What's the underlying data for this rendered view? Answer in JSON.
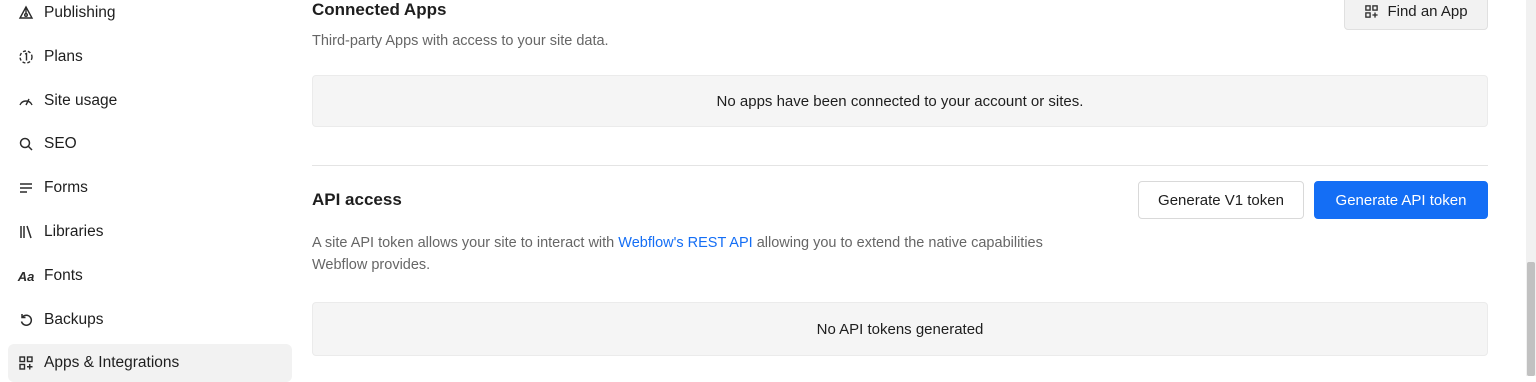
{
  "sidebar": {
    "items": [
      {
        "label": "Publishing",
        "icon": "publishing-icon"
      },
      {
        "label": "Plans",
        "icon": "plans-icon"
      },
      {
        "label": "Site usage",
        "icon": "gauge-icon"
      },
      {
        "label": "SEO",
        "icon": "search-icon"
      },
      {
        "label": "Forms",
        "icon": "forms-icon"
      },
      {
        "label": "Libraries",
        "icon": "libraries-icon"
      },
      {
        "label": "Fonts",
        "icon": "fonts-icon",
        "glyph": "Aa"
      },
      {
        "label": "Backups",
        "icon": "backup-icon"
      },
      {
        "label": "Apps & Integrations",
        "icon": "apps-icon",
        "active": true
      }
    ]
  },
  "connected_apps": {
    "title": "Connected Apps",
    "description": "Third-party Apps with access to your site data.",
    "find_button": "Find an App",
    "empty_text": "No apps have been connected to your account or sites."
  },
  "api_access": {
    "title": "API access",
    "v1_button": "Generate V1 token",
    "generate_button": "Generate API token",
    "description_before": "A site API token allows your site to interact with ",
    "description_link": "Webflow's REST API",
    "description_after": " allowing you to extend the native capabilities",
    "description_line2": "Webflow provides.",
    "empty_text": "No API tokens generated"
  },
  "colors": {
    "accent": "#146ef5",
    "active_bg": "#f2f2f2",
    "empty_bg": "#f5f5f5"
  }
}
